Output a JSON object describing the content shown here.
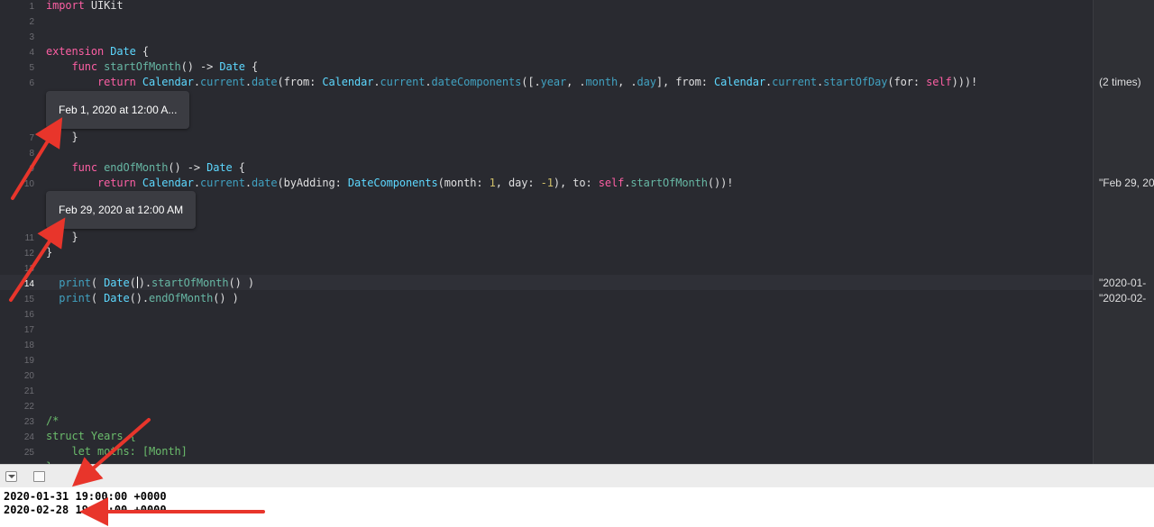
{
  "editor": {
    "line_numbers": [
      "1",
      "2",
      "3",
      "4",
      "5",
      "6",
      "7",
      "8",
      "9",
      "10",
      "11",
      "12",
      "13",
      "14",
      "15",
      "16",
      "17",
      "18",
      "19",
      "20",
      "21",
      "22",
      "23",
      "24",
      "25"
    ],
    "current_line": "14"
  },
  "popups": {
    "start_of_month": "Feb 1, 2020 at 12:00 A...",
    "end_of_month": "Feb 29, 2020 at 12:00 AM"
  },
  "results": {
    "line6": "(2 times)",
    "line10": "\"Feb 29, 20",
    "line14": "\"2020-01-",
    "line15": "\"2020-02-"
  },
  "console": {
    "lines": [
      "2020-01-31 19:00:00 +0000",
      "2020-02-28 19:00:00 +0000"
    ]
  },
  "colors": {
    "arrow": "#e8352b",
    "editor_bg": "#292a30",
    "keyword": "#fc5fa3",
    "type": "#5dd8ff"
  }
}
